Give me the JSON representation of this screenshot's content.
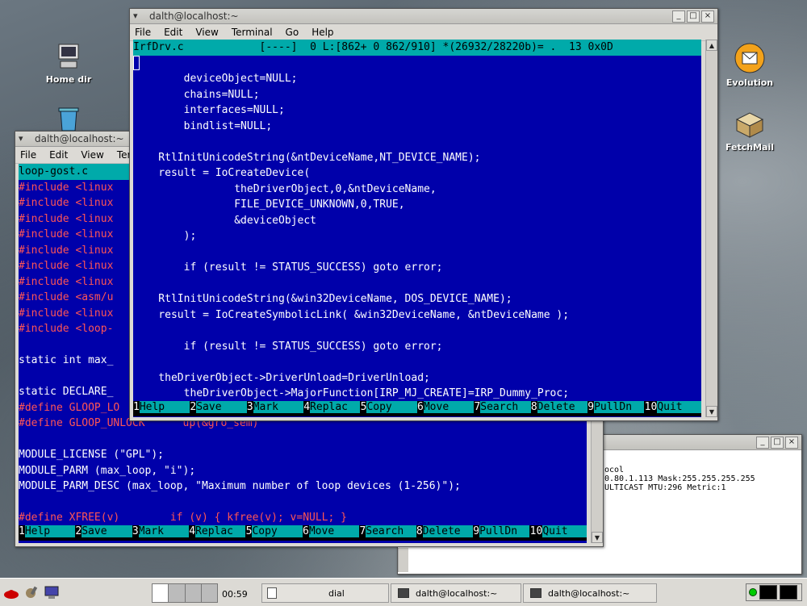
{
  "desktop": {
    "icons": [
      {
        "label": "Home dir"
      },
      {
        "label": "Evolution"
      },
      {
        "label": "FetchMail"
      }
    ]
  },
  "main_window": {
    "title": "dalth@localhost:~",
    "menu": [
      "File",
      "Edit",
      "View",
      "Terminal",
      "Go",
      "Help"
    ],
    "status_line": "IrfDrv.c            [----]  0 L:[862+ 0 862/910] *(26932/28220b)= .  13 0x0D",
    "code": [
      "",
      "        deviceObject=NULL;",
      "        chains=NULL;",
      "        interfaces=NULL;",
      "        bindlist=NULL;",
      "",
      "    RtlInitUnicodeString(&ntDeviceName,NT_DEVICE_NAME);",
      "    result = IoCreateDevice(",
      "                theDriverObject,0,&ntDeviceName,",
      "                FILE_DEVICE_UNKNOWN,0,TRUE,",
      "                &deviceObject",
      "        );",
      "",
      "        if (result != STATUS_SUCCESS) goto error;",
      "",
      "    RtlInitUnicodeString(&win32DeviceName, DOS_DEVICE_NAME);",
      "    result = IoCreateSymbolicLink( &win32DeviceName, &ntDeviceName );",
      "",
      "        if (result != STATUS_SUCCESS) goto error;",
      "",
      "    theDriverObject->DriverUnload=DriverUnload;",
      "        theDriverObject->MajorFunction[IRP_MJ_CREATE]=IRP_Dummy_Proc;"
    ],
    "fkeys": [
      {
        "n": "1",
        "label": "Help"
      },
      {
        "n": "2",
        "label": "Save"
      },
      {
        "n": "3",
        "label": "Mark"
      },
      {
        "n": "4",
        "label": "Replac"
      },
      {
        "n": "5",
        "label": "Copy"
      },
      {
        "n": "6",
        "label": "Move"
      },
      {
        "n": "7",
        "label": "Search"
      },
      {
        "n": "8",
        "label": "Delete"
      },
      {
        "n": "9",
        "label": "PullDn"
      },
      {
        "n": "10",
        "label": "Quit"
      }
    ]
  },
  "back_window": {
    "title": "dalth@localhost:~",
    "menu": [
      "File",
      "Edit",
      "View",
      "Ter"
    ],
    "status_line": "loop-gost.c",
    "code": [
      {
        "t": "#include <linux",
        "c": "red"
      },
      {
        "t": "#include <linux",
        "c": "red"
      },
      {
        "t": "#include <linux",
        "c": "red"
      },
      {
        "t": "#include <linux",
        "c": "red"
      },
      {
        "t": "#include <linux",
        "c": "red"
      },
      {
        "t": "#include <linux",
        "c": "red"
      },
      {
        "t": "#include <linux",
        "c": "red"
      },
      {
        "t": "#include <asm/u",
        "c": "red"
      },
      {
        "t": "#include <linux",
        "c": "red"
      },
      {
        "t": "#include <loop-",
        "c": "red"
      },
      {
        "t": "",
        "c": "code"
      },
      {
        "t": "static int max_",
        "c": "code"
      },
      {
        "t": "",
        "c": "code"
      },
      {
        "t": "static DECLARE_",
        "c": "code"
      },
      {
        "t": "#define GLOOP_LO",
        "c": "red"
      },
      {
        "t": "#define GLOOP_UNLOCK      up(&gro_sem)",
        "c": "red"
      },
      {
        "t": "",
        "c": "code"
      },
      {
        "t": "MODULE_LICENSE (\"GPL\");",
        "c": "code"
      },
      {
        "t": "MODULE_PARM (max_loop, \"i\");",
        "c": "code"
      },
      {
        "t": "MODULE_PARM_DESC (max_loop, \"Maximum number of loop devices (1-256)\");",
        "c": "code"
      },
      {
        "t": "",
        "c": "code"
      },
      {
        "t": "#define XFREE(v)        if (v) { kfree(v); v=NULL; }",
        "c": "red"
      }
    ]
  },
  "small_window": {
    "lines": [
      "ocol",
      "0.80.1.113  Mask:255.255.255.255",
      "ULTICAST  MTU:296  Metric:1"
    ]
  },
  "taskbar": {
    "clock": "00:59",
    "tasks": [
      "dial",
      "dalth@localhost:~",
      "dalth@localhost:~"
    ]
  }
}
